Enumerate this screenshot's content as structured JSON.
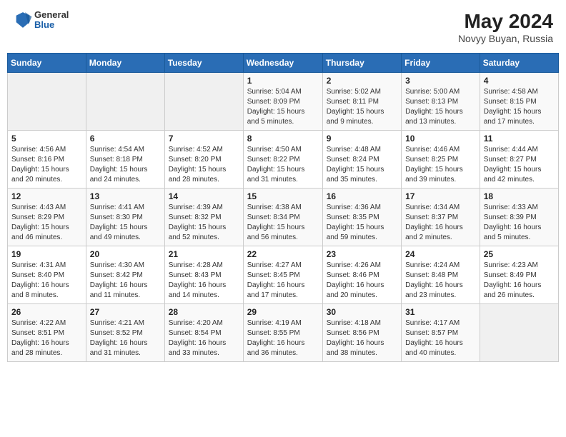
{
  "header": {
    "logo_general": "General",
    "logo_blue": "Blue",
    "month_year": "May 2024",
    "location": "Novyy Buyan, Russia"
  },
  "days_of_week": [
    "Sunday",
    "Monday",
    "Tuesday",
    "Wednesday",
    "Thursday",
    "Friday",
    "Saturday"
  ],
  "weeks": [
    [
      {
        "day": "",
        "info": ""
      },
      {
        "day": "",
        "info": ""
      },
      {
        "day": "",
        "info": ""
      },
      {
        "day": "1",
        "info": "Sunrise: 5:04 AM\nSunset: 8:09 PM\nDaylight: 15 hours\nand 5 minutes."
      },
      {
        "day": "2",
        "info": "Sunrise: 5:02 AM\nSunset: 8:11 PM\nDaylight: 15 hours\nand 9 minutes."
      },
      {
        "day": "3",
        "info": "Sunrise: 5:00 AM\nSunset: 8:13 PM\nDaylight: 15 hours\nand 13 minutes."
      },
      {
        "day": "4",
        "info": "Sunrise: 4:58 AM\nSunset: 8:15 PM\nDaylight: 15 hours\nand 17 minutes."
      }
    ],
    [
      {
        "day": "5",
        "info": "Sunrise: 4:56 AM\nSunset: 8:16 PM\nDaylight: 15 hours\nand 20 minutes."
      },
      {
        "day": "6",
        "info": "Sunrise: 4:54 AM\nSunset: 8:18 PM\nDaylight: 15 hours\nand 24 minutes."
      },
      {
        "day": "7",
        "info": "Sunrise: 4:52 AM\nSunset: 8:20 PM\nDaylight: 15 hours\nand 28 minutes."
      },
      {
        "day": "8",
        "info": "Sunrise: 4:50 AM\nSunset: 8:22 PM\nDaylight: 15 hours\nand 31 minutes."
      },
      {
        "day": "9",
        "info": "Sunrise: 4:48 AM\nSunset: 8:24 PM\nDaylight: 15 hours\nand 35 minutes."
      },
      {
        "day": "10",
        "info": "Sunrise: 4:46 AM\nSunset: 8:25 PM\nDaylight: 15 hours\nand 39 minutes."
      },
      {
        "day": "11",
        "info": "Sunrise: 4:44 AM\nSunset: 8:27 PM\nDaylight: 15 hours\nand 42 minutes."
      }
    ],
    [
      {
        "day": "12",
        "info": "Sunrise: 4:43 AM\nSunset: 8:29 PM\nDaylight: 15 hours\nand 46 minutes."
      },
      {
        "day": "13",
        "info": "Sunrise: 4:41 AM\nSunset: 8:30 PM\nDaylight: 15 hours\nand 49 minutes."
      },
      {
        "day": "14",
        "info": "Sunrise: 4:39 AM\nSunset: 8:32 PM\nDaylight: 15 hours\nand 52 minutes."
      },
      {
        "day": "15",
        "info": "Sunrise: 4:38 AM\nSunset: 8:34 PM\nDaylight: 15 hours\nand 56 minutes."
      },
      {
        "day": "16",
        "info": "Sunrise: 4:36 AM\nSunset: 8:35 PM\nDaylight: 15 hours\nand 59 minutes."
      },
      {
        "day": "17",
        "info": "Sunrise: 4:34 AM\nSunset: 8:37 PM\nDaylight: 16 hours\nand 2 minutes."
      },
      {
        "day": "18",
        "info": "Sunrise: 4:33 AM\nSunset: 8:39 PM\nDaylight: 16 hours\nand 5 minutes."
      }
    ],
    [
      {
        "day": "19",
        "info": "Sunrise: 4:31 AM\nSunset: 8:40 PM\nDaylight: 16 hours\nand 8 minutes."
      },
      {
        "day": "20",
        "info": "Sunrise: 4:30 AM\nSunset: 8:42 PM\nDaylight: 16 hours\nand 11 minutes."
      },
      {
        "day": "21",
        "info": "Sunrise: 4:28 AM\nSunset: 8:43 PM\nDaylight: 16 hours\nand 14 minutes."
      },
      {
        "day": "22",
        "info": "Sunrise: 4:27 AM\nSunset: 8:45 PM\nDaylight: 16 hours\nand 17 minutes."
      },
      {
        "day": "23",
        "info": "Sunrise: 4:26 AM\nSunset: 8:46 PM\nDaylight: 16 hours\nand 20 minutes."
      },
      {
        "day": "24",
        "info": "Sunrise: 4:24 AM\nSunset: 8:48 PM\nDaylight: 16 hours\nand 23 minutes."
      },
      {
        "day": "25",
        "info": "Sunrise: 4:23 AM\nSunset: 8:49 PM\nDaylight: 16 hours\nand 26 minutes."
      }
    ],
    [
      {
        "day": "26",
        "info": "Sunrise: 4:22 AM\nSunset: 8:51 PM\nDaylight: 16 hours\nand 28 minutes."
      },
      {
        "day": "27",
        "info": "Sunrise: 4:21 AM\nSunset: 8:52 PM\nDaylight: 16 hours\nand 31 minutes."
      },
      {
        "day": "28",
        "info": "Sunrise: 4:20 AM\nSunset: 8:54 PM\nDaylight: 16 hours\nand 33 minutes."
      },
      {
        "day": "29",
        "info": "Sunrise: 4:19 AM\nSunset: 8:55 PM\nDaylight: 16 hours\nand 36 minutes."
      },
      {
        "day": "30",
        "info": "Sunrise: 4:18 AM\nSunset: 8:56 PM\nDaylight: 16 hours\nand 38 minutes."
      },
      {
        "day": "31",
        "info": "Sunrise: 4:17 AM\nSunset: 8:57 PM\nDaylight: 16 hours\nand 40 minutes."
      },
      {
        "day": "",
        "info": ""
      }
    ]
  ]
}
